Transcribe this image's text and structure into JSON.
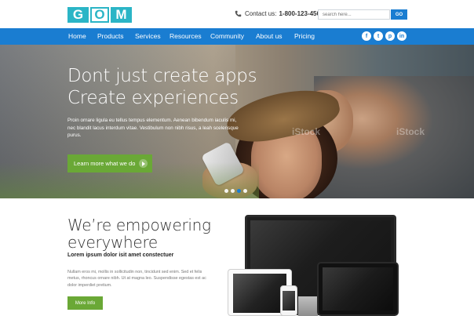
{
  "brand": {
    "logo_letters": [
      "G",
      "O",
      "M"
    ],
    "accent": "#1a7dd1",
    "logo_color": "#2bb5c6",
    "cta_color": "#6aa836"
  },
  "header": {
    "contact_label": "Contact us:",
    "contact_number": "1-800-123-4567",
    "phone_icon": "phone-icon",
    "search_placeholder": "search here...",
    "go_label": "GO"
  },
  "nav": {
    "items": [
      "Home",
      "Products",
      "Services",
      "Resources",
      "Community",
      "About us",
      "Pricing"
    ],
    "social": [
      {
        "icon": "facebook-icon",
        "glyph": "f"
      },
      {
        "icon": "twitter-icon",
        "glyph": "t"
      },
      {
        "icon": "pinterest-icon",
        "glyph": "p"
      },
      {
        "icon": "linkedin-icon",
        "glyph": "in"
      }
    ]
  },
  "hero": {
    "title_line1": "Dont just create apps",
    "title_line2": "Create experiences",
    "body": "Proin ornare ligula eu tellus tempus elementum. Aenean bibendum iaculis mi, nec blandit lacus interdum vitae. Vestibulum non nibh risus, a leah scelerisque purus.",
    "cta_label": "Learn more what we do",
    "watermark": "iStock",
    "slides": 4,
    "active_slide": 3
  },
  "section": {
    "heading_line1": "We’re empowering",
    "heading_line2": "everywhere",
    "subheading": "Lorem ipsum dolor isit amet constectuer",
    "paragraph": "Nullam eros mi, mollis in sollicitudin non, tincidunt sed enim. Sed et felis metus, rhoncus ornare nibh. Ut at magna leo. Suspendisse egestas est ac dolor imperdiet pretium.",
    "button_label": "More Info"
  }
}
